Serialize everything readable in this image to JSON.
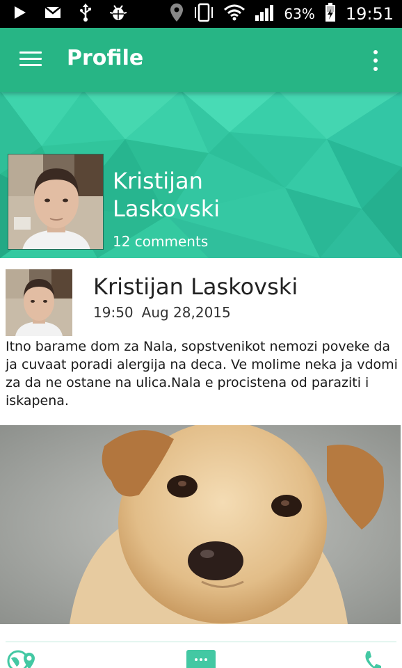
{
  "status_bar": {
    "icons": [
      "play-icon",
      "gmail-icon",
      "usb-icon",
      "android-debug-icon",
      "location-icon",
      "vibrate-icon",
      "wifi-icon",
      "signal-icon",
      "battery-icon"
    ],
    "battery_percent": "63%",
    "time": "19:51"
  },
  "app_bar": {
    "title": "Profile",
    "background_color": "#27b585"
  },
  "profile": {
    "first_name": "Kristijan",
    "last_name": "Laskovski",
    "comments": "12 comments"
  },
  "post": {
    "author": "Kristijan Laskovski",
    "time": "19:50",
    "date": "Aug 28,2015",
    "text": "Itno barame dom za Nala, sopstvenikot nemozi poveke da ja cuvaat poradi alergija na deca. Ve molime neka ja vdomi za da ne ostane na ulica.Nala e procistena od paraziti i iskapena."
  },
  "actions": {
    "icons": [
      "map-location-icon",
      "comment-icon",
      "phone-icon"
    ],
    "accent_color": "#43c8a3"
  }
}
